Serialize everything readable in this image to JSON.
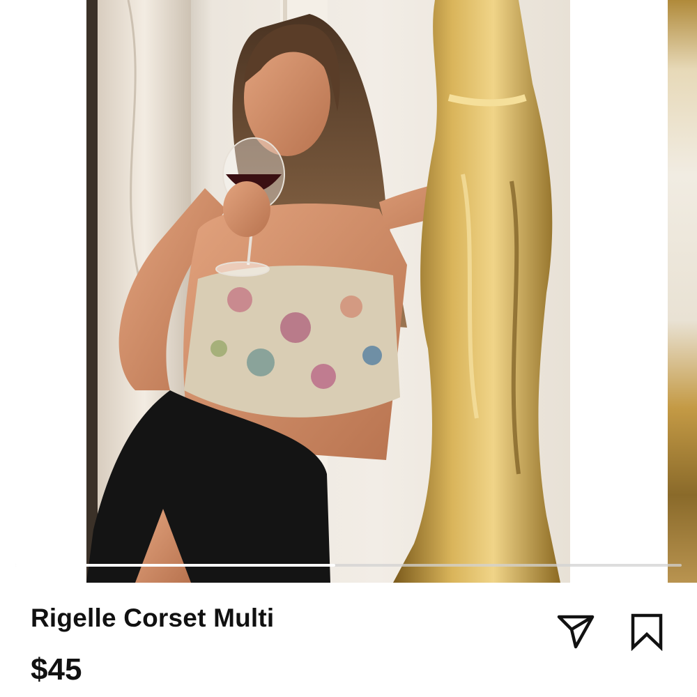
{
  "carousel": {
    "photo_count": 2,
    "current_photo": 1,
    "scroll_progress": 0.48,
    "photo_description_colors": {
      "statue": "#c9a24a",
      "skirt": "#141414",
      "wall": "#efe9df"
    }
  },
  "product": {
    "title": "Rigelle Corset Multi",
    "price": "$45"
  },
  "actions": {
    "share_icon": "paper-plane-icon",
    "save_icon": "bookmark-icon"
  },
  "colors": {
    "text": "#111111",
    "background": "#ffffff",
    "scrub_track": "#d2d2d2",
    "scrub_fill": "#ffffff"
  }
}
